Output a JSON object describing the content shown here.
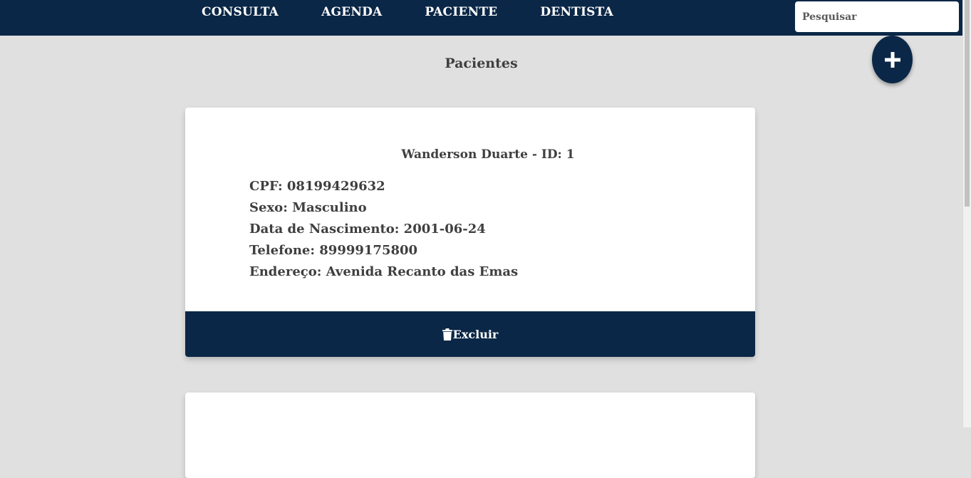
{
  "nav": {
    "items": [
      {
        "label": "CONSULTA"
      },
      {
        "label": "AGENDA"
      },
      {
        "label": "PACIENTE"
      },
      {
        "label": "DENTISTA"
      }
    ]
  },
  "search": {
    "placeholder": "Pesquisar"
  },
  "page": {
    "title": "Pacientes"
  },
  "colors": {
    "primary": "#0b2747",
    "background": "#e0e0e0",
    "card": "#ffffff",
    "text": "#3f3f3f"
  },
  "add_button": {
    "icon": "plus-icon"
  },
  "patients": [
    {
      "title": "Wanderson Duarte - ID: 1",
      "cpf": "CPF: 08199429632",
      "sexo": "Sexo: Masculino",
      "nascimento": "Data de Nascimento: 2001-06-24",
      "telefone": "Telefone: 89999175800",
      "endereco": "Endereço: Avenida Recanto das Emas",
      "delete_label": "Excluir",
      "delete_icon": "trash-icon"
    }
  ]
}
